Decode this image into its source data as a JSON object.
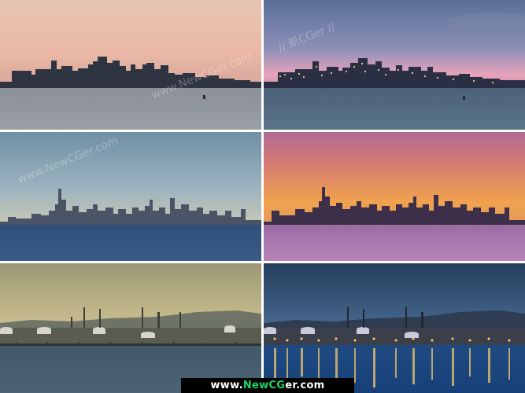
{
  "watermarks": {
    "top_left": "www.NewCGer.com",
    "top_right": "// 新CGer //",
    "mid_left": "www.NewCGer.com"
  },
  "footer": {
    "prefix": "www.",
    "brand_new": "New",
    "brand_cg": "CG",
    "suffix": "er.com"
  }
}
